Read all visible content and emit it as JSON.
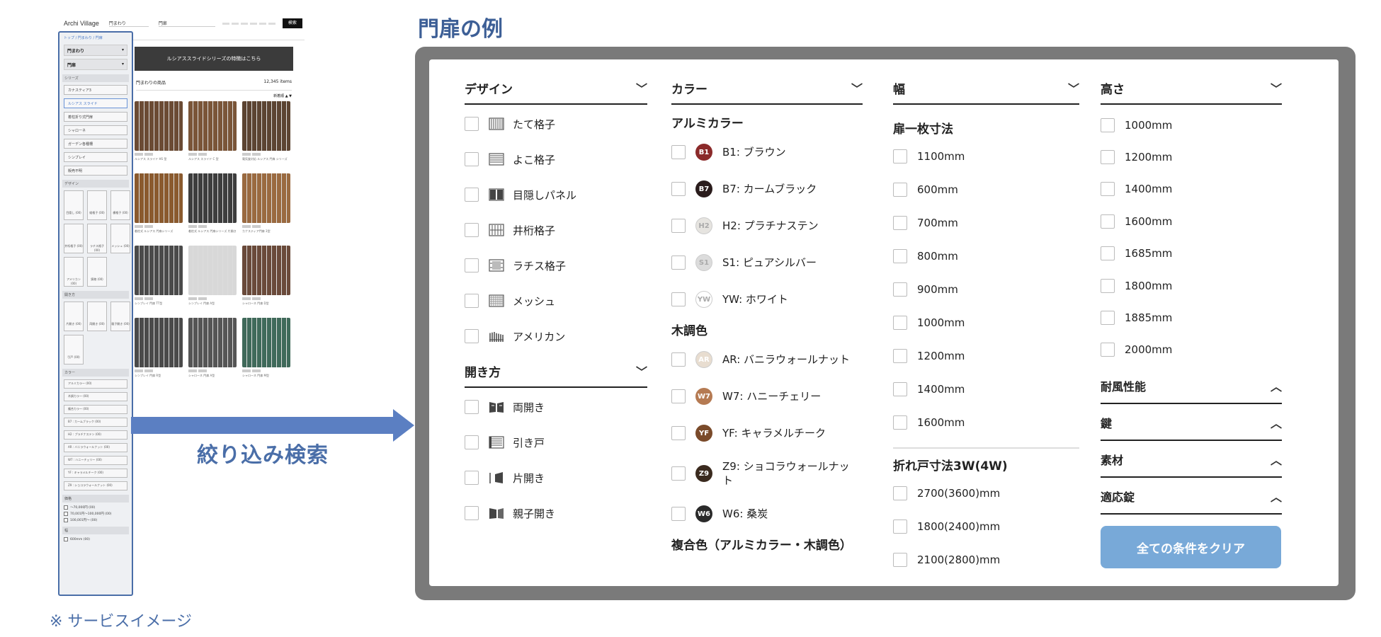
{
  "mini": {
    "logo": "Archi Village",
    "select1": "門まわり",
    "select2": "門扉",
    "search_button": "検索",
    "crumb": "トップ / 門まわり / 門扉",
    "dd1": "門まわり",
    "dd2": "門扉",
    "series_head": "シリーズ",
    "series": [
      "カナスティア3",
      "ルシアス スライド",
      "着柱折り式門扉",
      "シャローネ",
      "ガーデン各種柵",
      "シンプレイ",
      "販売不明"
    ],
    "series_selected": 1,
    "design_head": "デザイン",
    "design_tiles": [
      "目隠し (00)",
      "縦格子 (00)",
      "横格子 (00)",
      "井桁格子 (00)",
      "ラチス格子 (00)",
      "メッシュ (00)",
      "アメリカン (00)",
      "鋳物 (00)"
    ],
    "open_head": "開き方",
    "open_tiles": [
      "片開き (00)",
      "両開き (00)",
      "親子開き (00)",
      "引戸 (00)"
    ],
    "color_head": "カラー",
    "colors": [
      "アルミカラー (00)",
      "木調カラー (00)",
      "複合カラー (00)",
      "B7 : カームブラック (00)",
      "H2 : プラチナステン (00)",
      "AR : バニラウォールナット (00)",
      "W7 : ハニーチェリー (00)",
      "YF : キャラメルチーク (00)",
      "Z9 : ショコラウォールナット (00)"
    ],
    "price_head": "価格",
    "prices": [
      "〜70,000円 (00)",
      "70,001円〜100,000円 (00)",
      "100,001円〜 (00)"
    ],
    "width_head": "幅",
    "width_first": "600mm (00)",
    "banner": "ルシアススライドシリーズの特徴はこちら",
    "list_title": "門まわりの商品",
    "list_count": "12,345 items",
    "sort": "新着順 ▲ ▼",
    "products": [
      {
        "name": "ルシアス スライド HS 型",
        "color": "#6b4b34"
      },
      {
        "name": "ルシアス スライド C 型",
        "color": "#7a5538"
      },
      {
        "name": "電気錠対応 ルシアス 門扉 シリーズ",
        "color": "#5c4432"
      },
      {
        "name": "着柱式 ルシアス 門扉シリーズ",
        "color": "#8a5a2e"
      },
      {
        "name": "着柱式 ルシアス 門扉シリーズ 片開き",
        "color": "#3d3d3d"
      },
      {
        "name": "カナスティア門扉 3型",
        "color": "#9a6a40"
      },
      {
        "name": "シンプレイ 門扉 TT型",
        "color": "#4a4a4a"
      },
      {
        "name": "シンプレイ 門扉 A型",
        "color": "#d8d8d8"
      },
      {
        "name": "シャローネ 門扉 D型",
        "color": "#6a4a3a"
      },
      {
        "name": "シンプレイ 門扉 R型",
        "color": "#4a4a4a"
      },
      {
        "name": "シャローネ 門扉 A型",
        "color": "#555555"
      },
      {
        "name": "シャローネ 門扉 M型",
        "color": "#3f6a5a"
      }
    ]
  },
  "arrow_label": "絞り込み検索",
  "service_note": "※ サービスイメージ",
  "main_title": "門扉の例",
  "filters": {
    "design": {
      "title": "デザイン",
      "options": [
        {
          "label": "たて格子",
          "icon": "vertical-lattice-icon"
        },
        {
          "label": "よこ格子",
          "icon": "horizontal-lattice-icon"
        },
        {
          "label": "目隠しパネル",
          "icon": "privacy-panel-icon"
        },
        {
          "label": "井桁格子",
          "icon": "grid-lattice-icon"
        },
        {
          "label": "ラチス格子",
          "icon": "lattice-icon"
        },
        {
          "label": "メッシュ",
          "icon": "mesh-icon"
        },
        {
          "label": "アメリカン",
          "icon": "american-gate-icon"
        }
      ]
    },
    "opening": {
      "title": "開き方",
      "options": [
        {
          "label": "両開き",
          "icon": "double-swing-icon"
        },
        {
          "label": "引き戸",
          "icon": "sliding-door-icon"
        },
        {
          "label": "片開き",
          "icon": "single-swing-icon"
        },
        {
          "label": "親子開き",
          "icon": "parent-child-swing-icon"
        }
      ]
    },
    "color": {
      "title": "カラー",
      "aluminum_title": "アルミカラー",
      "aluminum": [
        {
          "code": "B1",
          "label": "B1: ブラウン",
          "bg": "#8b2a2a",
          "fg": "#ffffff"
        },
        {
          "code": "B7",
          "label": "B7: カームブラック",
          "bg": "#2a1c1c",
          "fg": "#ffffff"
        },
        {
          "code": "H2",
          "label": "H2: プラチナステン",
          "bg": "#e6e4e0",
          "fg": "#aaaaaa"
        },
        {
          "code": "S1",
          "label": "S1: ピュアシルバー",
          "bg": "#dcdcdc",
          "fg": "#aaaaaa"
        },
        {
          "code": "YW",
          "label": "YW: ホワイト",
          "bg": "#ffffff",
          "fg": "#aaaaaa"
        }
      ],
      "wood_title": "木調色",
      "wood": [
        {
          "code": "AR",
          "label": "AR: バニラウォールナット",
          "bg": "#e8ddd0",
          "fg": "#ffffff"
        },
        {
          "code": "W7",
          "label": "W7: ハニーチェリー",
          "bg": "#b57a52",
          "fg": "#ffffff"
        },
        {
          "code": "YF",
          "label": "YF: キャラメルチーク",
          "bg": "#7a4a2a",
          "fg": "#ffffff"
        },
        {
          "code": "Z9",
          "label": "Z9: ショコラウォールナット",
          "bg": "#3a2a1e",
          "fg": "#ffffff"
        },
        {
          "code": "W6",
          "label": "W6: 桑炭",
          "bg": "#2a2a2a",
          "fg": "#ffffff"
        }
      ],
      "combo_title": "複合色（アルミカラー・木調色）"
    },
    "width": {
      "title": "幅",
      "single_title": "扉一枚寸法",
      "single": [
        "1100mm",
        "600mm",
        "700mm",
        "800mm",
        "900mm",
        "1000mm",
        "1200mm",
        "1400mm",
        "1600mm"
      ],
      "fold_title": "折れ戸寸法3W(4W)",
      "fold": [
        "2700(3600)mm",
        "1800(2400)mm",
        "2100(2800)mm"
      ]
    },
    "height": {
      "title": "高さ",
      "options": [
        "1000mm",
        "1200mm",
        "1400mm",
        "1600mm",
        "1685mm",
        "1800mm",
        "1885mm",
        "2000mm"
      ]
    },
    "accordions": [
      "耐風性能",
      "鍵",
      "素材",
      "適応錠"
    ],
    "clear_button": "全ての条件をクリア"
  }
}
